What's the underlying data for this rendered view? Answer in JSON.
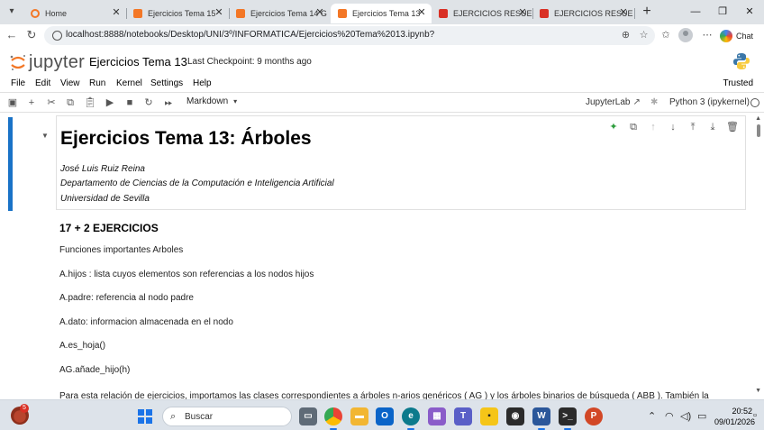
{
  "browser": {
    "tabs": [
      {
        "title": "Home",
        "icon_color": "#f37726",
        "active": false
      },
      {
        "title": "Ejercicios Tema 15",
        "icon_color": "#f37726",
        "active": false
      },
      {
        "title": "Ejercicios Tema 14 G",
        "icon_color": "#f37726",
        "active": false
      },
      {
        "title": "Ejercicios Tema 13",
        "icon_color": "#f37726",
        "active": true
      },
      {
        "title": "EJERCICIOS RESUELT",
        "icon_color": "#d93025",
        "active": false
      },
      {
        "title": "EJERCICIOS RESUELT",
        "icon_color": "#d93025",
        "active": false
      }
    ],
    "url": "localhost:8888/notebooks/Desktop/UNI/3º/INFORMATICA/Ejercicios%20Tema%2013.ipynb?",
    "chat_label": "Chat"
  },
  "jupyter": {
    "logo_text": "jupyter",
    "notebook_title": "Ejercicios Tema 13",
    "checkpoint": "Last Checkpoint: 9 months ago",
    "menu": [
      "File",
      "Edit",
      "View",
      "Run",
      "Kernel",
      "Settings",
      "Help"
    ],
    "trusted": "Trusted",
    "cell_type": "Markdown",
    "jupyterlab_link": "JupyterLab",
    "kernel": "Python 3 (ipykernel)"
  },
  "notebook": {
    "heading": "Ejercicios Tema 13: Árboles",
    "author_lines": [
      "José Luis Ruiz Reina",
      "Departamento de Ciencias de la Computación e Inteligencia Artificial",
      "Universidad de Sevilla"
    ],
    "section_heading": "17 + 2 EJERCICIOS",
    "paragraphs": [
      "Funciones importantes Arboles",
      "A.hijos : lista cuyos elementos son referencias a los nodos hijos",
      "A.padre: referencia al nodo padre",
      "A.dato: informacion almacenada en el nodo",
      "A.es_hoja()",
      "AG.añade_hijo(h)",
      "Para esta relación de ejercicios, importamos las clases correspondientes a árboles n-arios genéricos ( AG ) y los árboles binarios de búsqueda ( ABB ). También la"
    ]
  },
  "taskbar": {
    "weather_badge": "5",
    "search_placeholder": "Buscar",
    "time": "20:52",
    "date": "09/01/2026"
  },
  "icons": {
    "accent": "#1a73c7",
    "jupyter_orange": "#f37726"
  }
}
